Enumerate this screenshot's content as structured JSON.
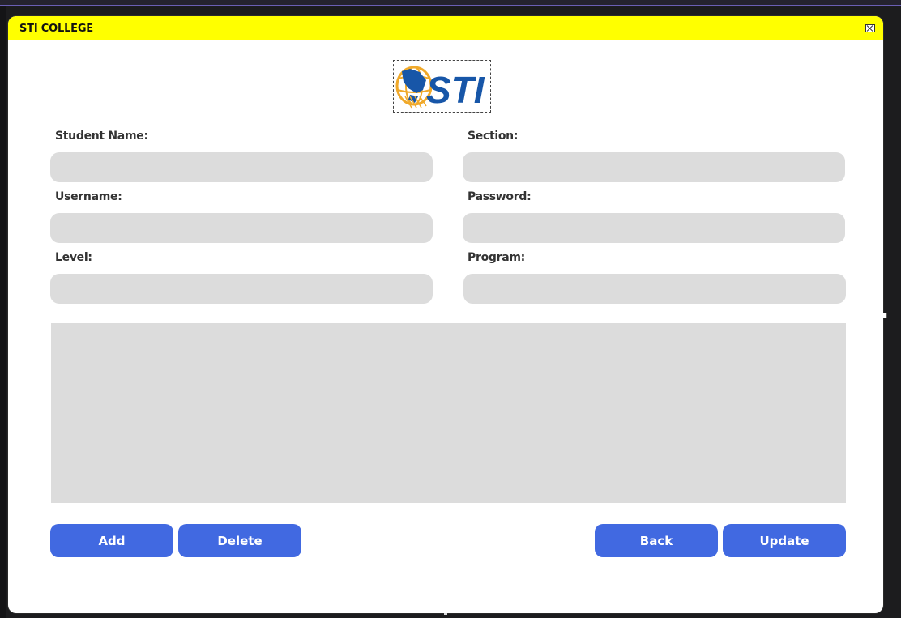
{
  "window": {
    "title": "STI COLLEGE",
    "title_bar_color": "#ffff00",
    "close_icon": "close-icon"
  },
  "logo": {
    "text": "STI",
    "icon": "globe-icon",
    "colors": {
      "blue": "#1756a8",
      "gold": "#f0a92a"
    }
  },
  "form": {
    "student_name": {
      "label": "Student Name:",
      "value": ""
    },
    "section": {
      "label": "Section:",
      "value": ""
    },
    "username": {
      "label": "Username:",
      "value": ""
    },
    "password": {
      "label": "Password:",
      "value": ""
    },
    "level": {
      "label": "Level:",
      "value": ""
    },
    "program": {
      "label": "Program:",
      "value": ""
    }
  },
  "buttons": {
    "add": "Add",
    "delete": "Delete",
    "back": "Back",
    "update": "Update",
    "color": "#4169e1"
  }
}
